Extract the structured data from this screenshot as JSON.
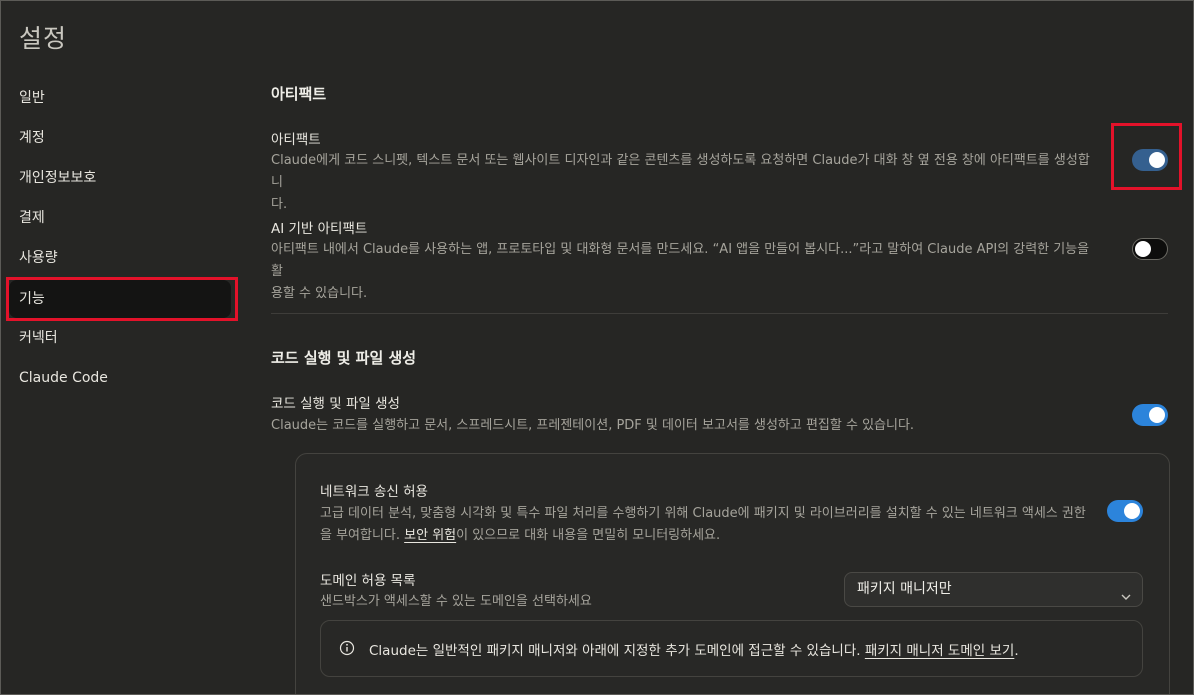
{
  "page": {
    "title": "설정"
  },
  "sidebar": {
    "items": [
      {
        "label": "일반"
      },
      {
        "label": "계정"
      },
      {
        "label": "개인정보보호"
      },
      {
        "label": "결제"
      },
      {
        "label": "사용량"
      },
      {
        "label": "기능",
        "active": true
      },
      {
        "label": "커넥터"
      },
      {
        "label": "Claude Code"
      }
    ]
  },
  "artifacts_section": {
    "title": "아티팩트",
    "artifacts": {
      "title": "아티팩트",
      "desc_line1": "Claude에게 코드 스니펫, 텍스트 문서 또는 웹사이트 디자인과 같은 콘텐츠를 생성하도록 요청하면 Claude가 대화 창 옆 전용 창에 아티팩트를 생성합니",
      "desc_line2": "다.",
      "enabled": true
    },
    "ai_artifacts": {
      "title": "AI 기반 아티팩트",
      "desc_line1": "아티팩트 내에서 Claude를 사용하는 앱, 프로토타입 및 대화형 문서를 만드세요. “AI 앱을 만들어 봅시다...”라고 말하여 Claude API의 강력한 기능을 활",
      "desc_line2": "용할 수 있습니다.",
      "enabled": false
    }
  },
  "code_section": {
    "title": "코드 실행 및 파일 생성",
    "code_exec": {
      "title": "코드 실행 및 파일 생성",
      "desc": "Claude는 코드를 실행하고 문서, 스프레드시트, 프레젠테이션, PDF 및 데이터 보고서를 생성하고 편집할 수 있습니다.",
      "enabled": true
    },
    "network": {
      "title": "네트워크 송신 허용",
      "desc_line1": "고급 데이터 분석, 맞춤형 시각화 및 특수 파일 처리를 수행하기 위해 Claude에 패키지 및 라이브러리를 설치할 수 있는 네트워크 액세스 권한",
      "desc_line2_pre": "을 부여합니다. ",
      "desc_line2_link": "보안 위험",
      "desc_line2_post": "이 있으므로 대화 내용을 면밀히 모니터링하세요.",
      "enabled": true
    },
    "domain_allowlist": {
      "title": "도메인 허용 목록",
      "desc": "샌드박스가 액세스할 수 있는 도메인을 선택하세요",
      "selected": "패키지 매니저만"
    },
    "info": {
      "text": "Claude는 일반적인 패키지 매니저와 아래에 지정한 추가 도메인에 접근할 수 있습니다. ",
      "link": "패키지 매니저 도메인 보기",
      "suffix": "."
    }
  },
  "colors": {
    "background": "#262624",
    "toggle_on": "#2c84db",
    "highlight": "#e3122a"
  },
  "icons": [
    "info-icon",
    "chevron-down-icon"
  ]
}
